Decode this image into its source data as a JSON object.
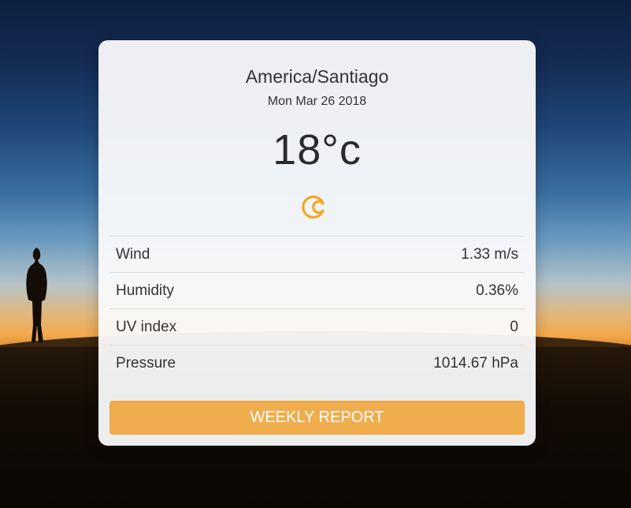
{
  "location": {
    "timezone": "America/Santiago",
    "date": "Mon Mar 26 2018"
  },
  "current": {
    "temperature": "18°c",
    "icon": "crescent-moon-icon",
    "icon_color": "#f5a623"
  },
  "stats": [
    {
      "label": "Wind",
      "value": "1.33 m/s"
    },
    {
      "label": "Humidity",
      "value": "0.36%"
    },
    {
      "label": "UV index",
      "value": "0"
    },
    {
      "label": "Pressure",
      "value": "1014.67 hPa"
    }
  ],
  "actions": {
    "weekly_report_label": "WEEKLY REPORT"
  },
  "colors": {
    "button": "#f0ad4e",
    "card_background": "#fafafb"
  }
}
